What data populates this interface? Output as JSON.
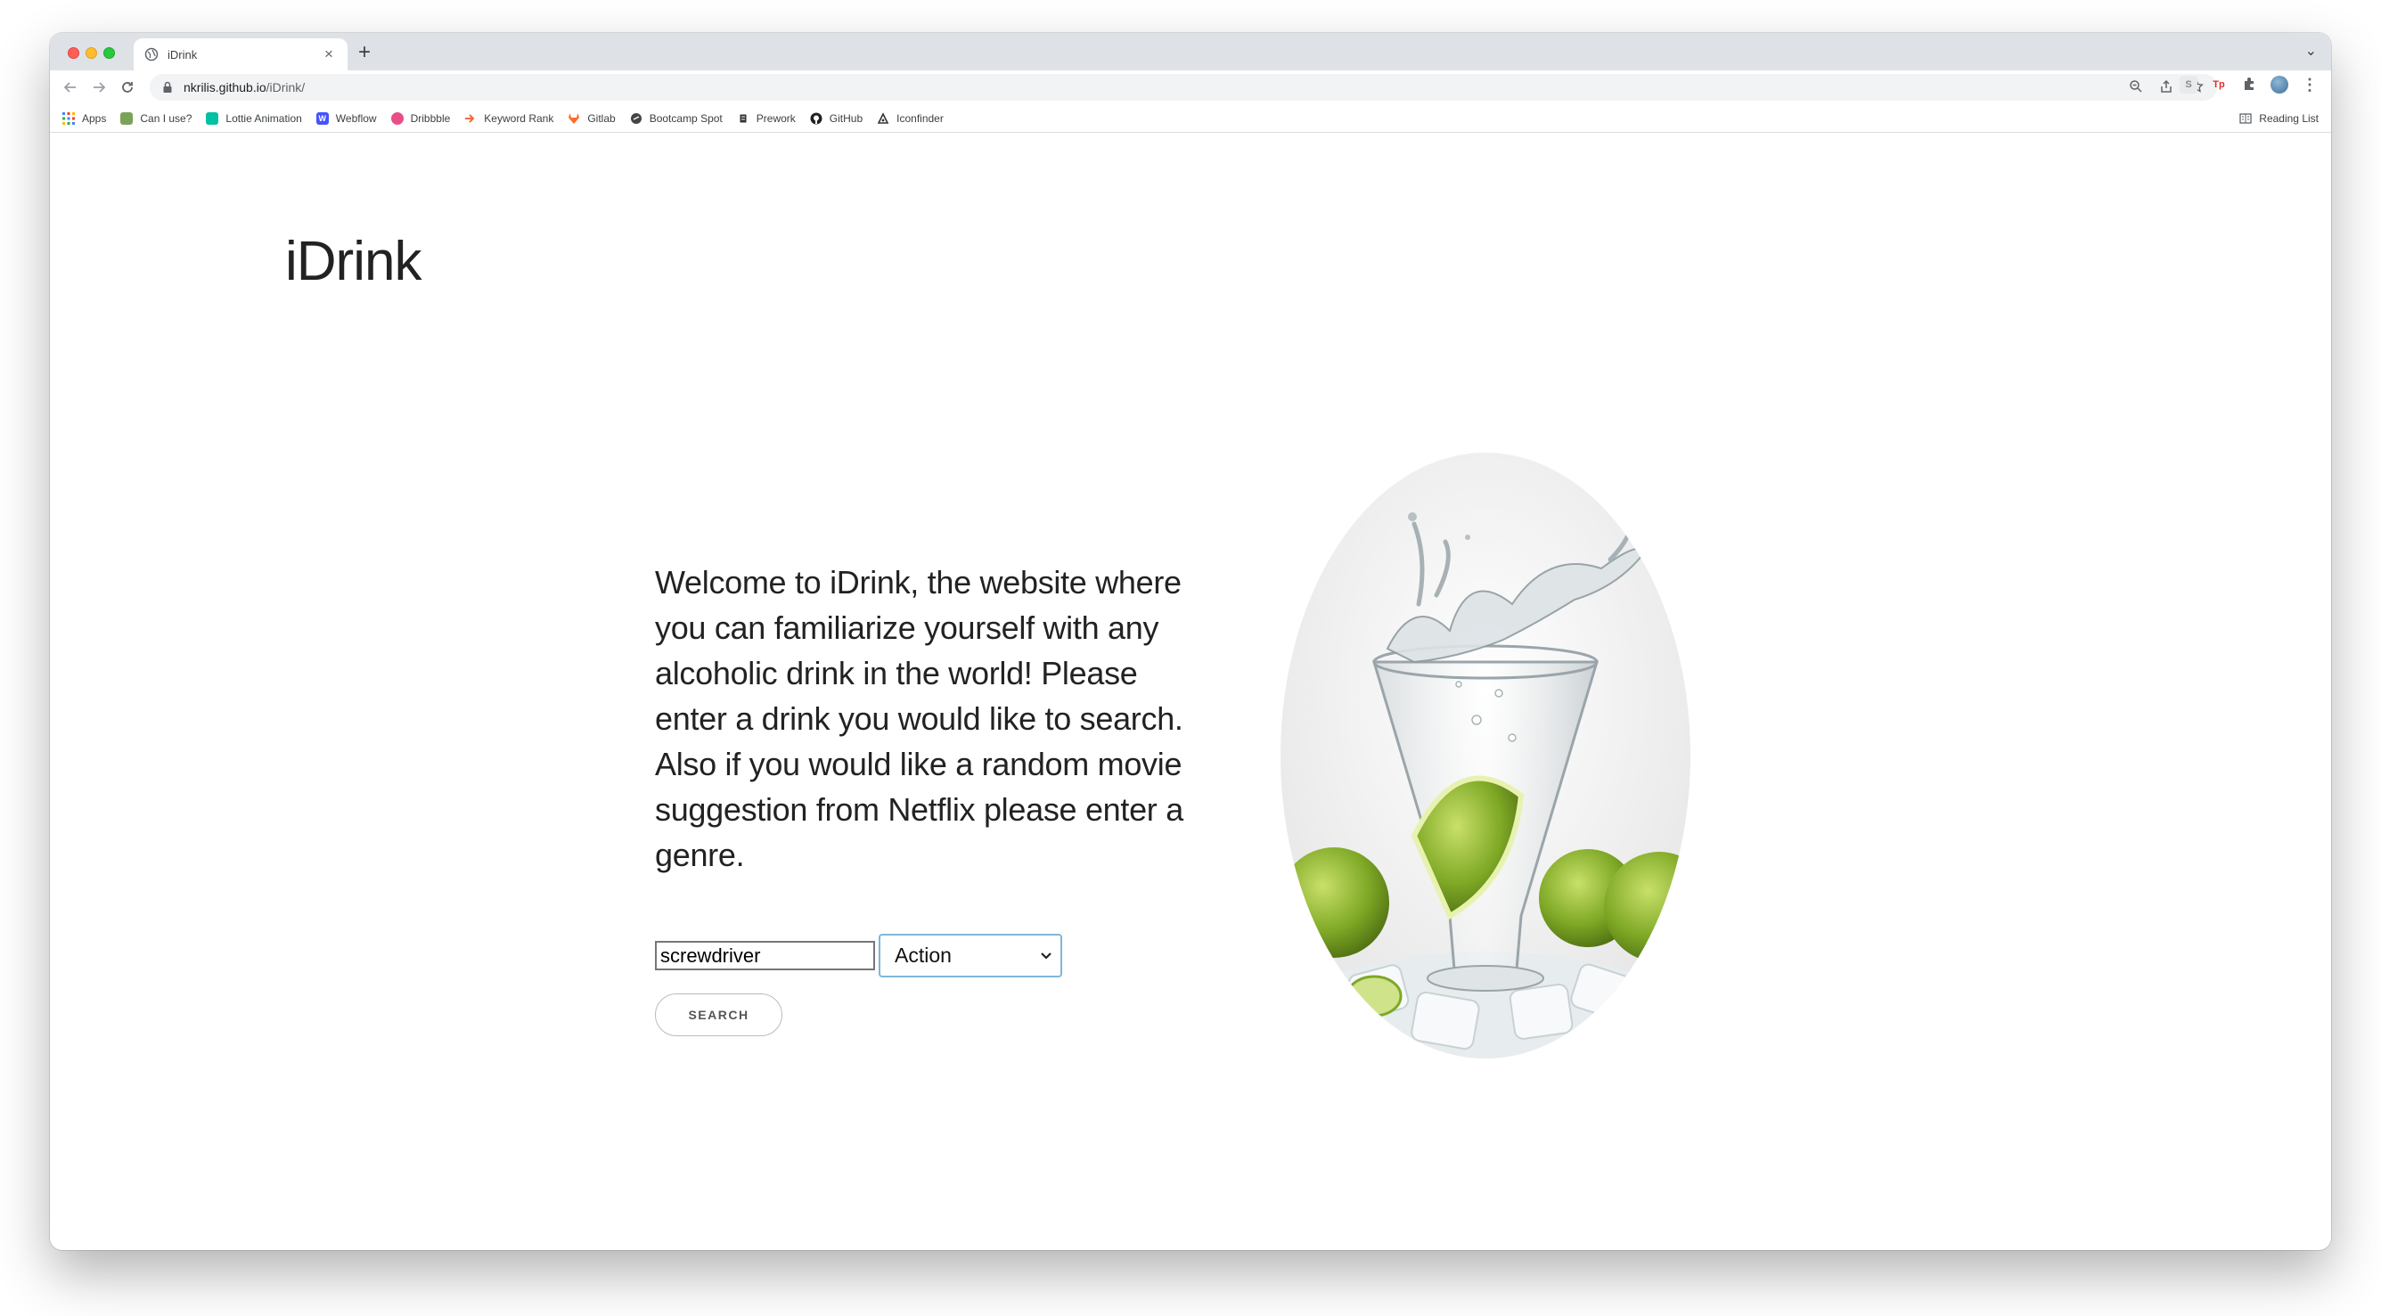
{
  "browser": {
    "tab_title": "iDrink",
    "new_tab": "+",
    "url_host": "nkrilis.github.io",
    "url_path": "/iDrink/",
    "bookmarks": [
      {
        "label": "Apps",
        "icon": "apps-grid-icon",
        "color": "#4285f4"
      },
      {
        "label": "Can I use?",
        "icon": "caniuse-icon",
        "color": "#7aa35a"
      },
      {
        "label": "Lottie Animation",
        "icon": "lottie-icon",
        "color": "#00c1a2"
      },
      {
        "label": "Webflow",
        "icon": "webflow-icon",
        "color": "#4353ff"
      },
      {
        "label": "Dribbble",
        "icon": "dribbble-icon",
        "color": "#ea4c89"
      },
      {
        "label": "Keyword Rank",
        "icon": "keyword-rank-icon",
        "color": "#f26b3a"
      },
      {
        "label": "Gitlab",
        "icon": "gitlab-icon",
        "color": "#fc6d26"
      },
      {
        "label": "Bootcamp Spot",
        "icon": "bootcamp-icon",
        "color": "#444444"
      },
      {
        "label": "Prework",
        "icon": "prework-icon",
        "color": "#333333"
      },
      {
        "label": "GitHub",
        "icon": "github-icon",
        "color": "#222222"
      },
      {
        "label": "Iconfinder",
        "icon": "iconfinder-icon",
        "color": "#333333"
      }
    ],
    "reading_list": "Reading List"
  },
  "page": {
    "site_title": "iDrink",
    "intro_text": "Welcome to iDrink, the website where you can familiarize yourself with any alcoholic drink in the world! Please enter a drink you would like to search. Also if you would like a random movie suggestion from Netflix please enter a genre.",
    "drink_input_value": "screwdriver",
    "genre_selected": "Action",
    "search_label": "SEARCH"
  }
}
